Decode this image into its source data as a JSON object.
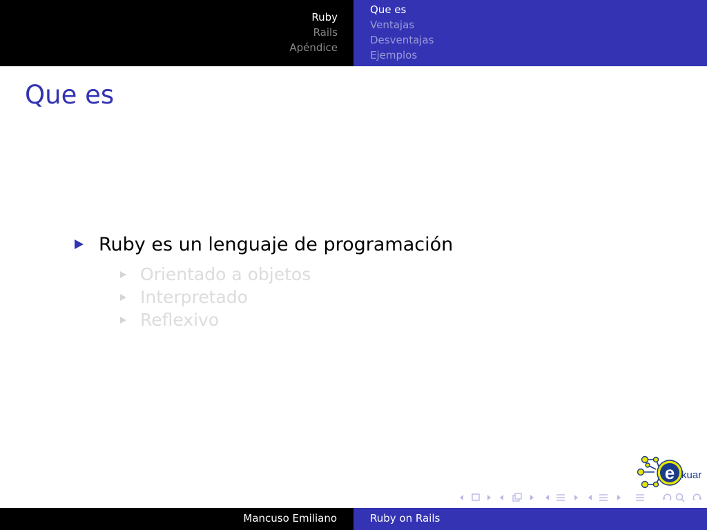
{
  "header": {
    "sections": [
      {
        "label": "Ruby",
        "active": true
      },
      {
        "label": "Rails",
        "active": false
      },
      {
        "label": "Apéndice",
        "active": false
      }
    ],
    "subsections": [
      {
        "label": "Que es",
        "active": true
      },
      {
        "label": "Ventajas",
        "active": false
      },
      {
        "label": "Desventajas",
        "active": false
      },
      {
        "label": "Ejemplos",
        "active": false
      }
    ]
  },
  "frame": {
    "title": "Que es",
    "bullet": "Ruby es un lenguaje de programación",
    "subitems": [
      "Orientado a objetos",
      "Interpretado",
      "Reflexivo"
    ]
  },
  "logo": {
    "text": "kuar",
    "letter": "e"
  },
  "footer": {
    "author": "Mancuso Emiliano",
    "title": "Ruby on Rails"
  },
  "colors": {
    "beamer_blue": "#3333b3",
    "header_black": "#000000",
    "logo_yellow": "#e6e600",
    "logo_blue": "#1a3a8a"
  },
  "icons": {
    "nav": [
      "nav-frame-icon",
      "nav-subsection-icon",
      "nav-section-icon",
      "nav-document-icon",
      "nav-align-icon",
      "nav-search-icon"
    ]
  }
}
